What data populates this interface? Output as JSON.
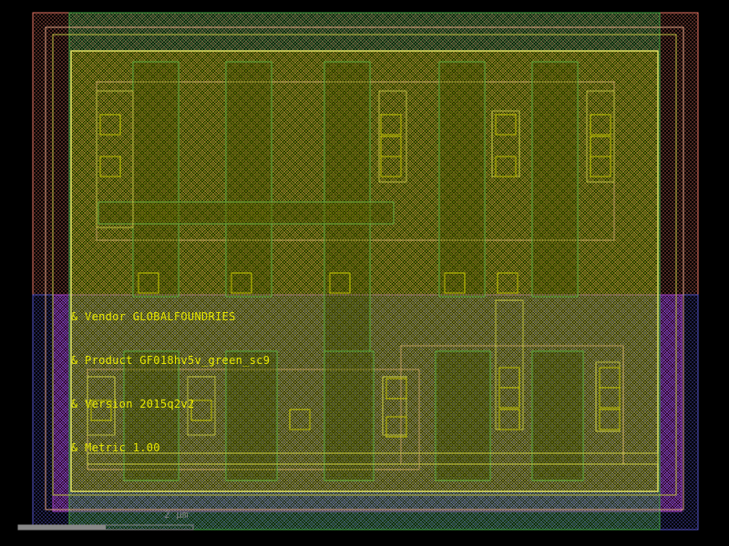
{
  "labels": {
    "vendor": "& Vendor GLOBALFOUNDRIES",
    "product": "& Product GF018hv5v_green_sc9",
    "version": "& Version 2015q2v2",
    "metric": "& Metric 1.00"
  },
  "scale_bar": {
    "text": "2 µm"
  },
  "colors": {
    "background": "#000000",
    "nwell": "#e07060",
    "pwell": "#5050c0",
    "diffusion": "#40a040",
    "poly": "#d0d000",
    "metal1": "#c0c040",
    "contact": "#c0c000",
    "purple_fill": "#a040c0",
    "cell_outline": "#e0e060"
  }
}
